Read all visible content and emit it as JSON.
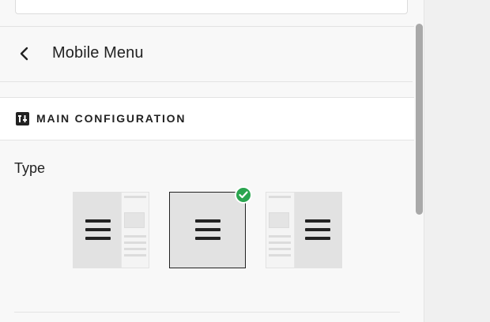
{
  "header": {
    "back_label": "back",
    "title": "Mobile Menu"
  },
  "section": {
    "title": "MAIN CONFIGURATION",
    "icon": "layout-settings-icon"
  },
  "type_field": {
    "label": "Type",
    "options": [
      {
        "name": "menu-left-panel",
        "selected": false
      },
      {
        "name": "menu-fullscreen",
        "selected": true
      },
      {
        "name": "menu-right-panel",
        "selected": false
      }
    ]
  },
  "colors": {
    "accent_check": "#2aa54f",
    "selected_border": "#222222"
  }
}
